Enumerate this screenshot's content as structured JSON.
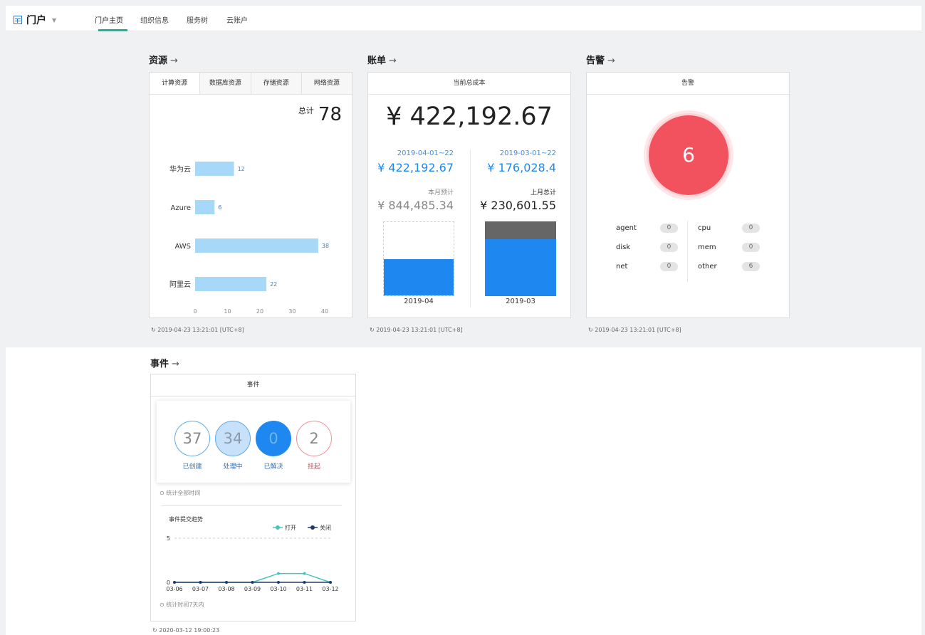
{
  "nav": {
    "brand": "门户",
    "tabs": [
      "门户主页",
      "组织信息",
      "服务树",
      "云账户"
    ]
  },
  "resources": {
    "title": "资源",
    "arrow": "→",
    "tabs": [
      "计算资源",
      "数据库资源",
      "存储资源",
      "网络资源"
    ],
    "total_label": "总计",
    "total_value": "78",
    "refresh": "2019-04-23 13:21:01 [UTC+8]",
    "chart_data": {
      "type": "bar",
      "orientation": "horizontal",
      "categories": [
        "华为云",
        "Azure",
        "AWS",
        "阿里云"
      ],
      "values": [
        12,
        6,
        38,
        22
      ],
      "xlim": [
        0,
        40
      ],
      "xticks": [
        "0",
        "10",
        "20",
        "30",
        "40"
      ],
      "color": "#a8d8f8"
    }
  },
  "bill": {
    "title": "账单",
    "arrow": "→",
    "head": "当前总成本",
    "total": "¥ 422,192.67",
    "left": {
      "range": "2019-04-01~22",
      "amount": "¥ 422,192.67",
      "forecast_label": "本月预计",
      "forecast": "¥ 844,485.34",
      "bar_label": "2019-04",
      "fill_ratio": 0.5
    },
    "right": {
      "range": "2019-03-01~22",
      "amount": "¥ 176,028.4",
      "forecast_label": "上月总计",
      "forecast": "¥ 230,601.55",
      "bar_label": "2019-03",
      "fill_ratio": 0.76
    },
    "refresh": "2019-04-23 13:21:01 [UTC+8]"
  },
  "alarm": {
    "title": "告警",
    "arrow": "→",
    "head": "告警",
    "count": "6",
    "items": [
      {
        "name": "agent",
        "value": "0"
      },
      {
        "name": "cpu",
        "value": "0"
      },
      {
        "name": "disk",
        "value": "0"
      },
      {
        "name": "mem",
        "value": "0"
      },
      {
        "name": "net",
        "value": "0"
      },
      {
        "name": "other",
        "value": "6"
      }
    ],
    "refresh": "2019-04-23 13:21:01 [UTC+8]"
  },
  "events": {
    "title": "事件",
    "arrow": "→",
    "head": "事件",
    "stats": [
      {
        "value": "37",
        "label": "已创建"
      },
      {
        "value": "34",
        "label": "处理中"
      },
      {
        "value": "0",
        "label": "已解决"
      },
      {
        "value": "2",
        "label": "挂起"
      }
    ],
    "note_all": "统计全部时间",
    "trend_title": "事件提交趋势",
    "legend_open": "打开",
    "legend_close": "关闭",
    "note_7days": "统计时间7天内",
    "refresh": "2020-03-12 19:00:23",
    "chart_data": {
      "type": "line",
      "x": [
        "03-06",
        "03-07",
        "03-08",
        "03-09",
        "03-10",
        "03-11",
        "03-12"
      ],
      "ylim": [
        0,
        5
      ],
      "yticks": [
        "0",
        "5"
      ],
      "series": [
        {
          "name": "打开",
          "values": [
            0,
            0,
            0,
            0,
            1,
            1,
            0
          ],
          "color": "#4dc4b8"
        },
        {
          "name": "关闭",
          "values": [
            0,
            0,
            0,
            0,
            0,
            0,
            0
          ],
          "color": "#1f3c6e"
        }
      ]
    }
  }
}
